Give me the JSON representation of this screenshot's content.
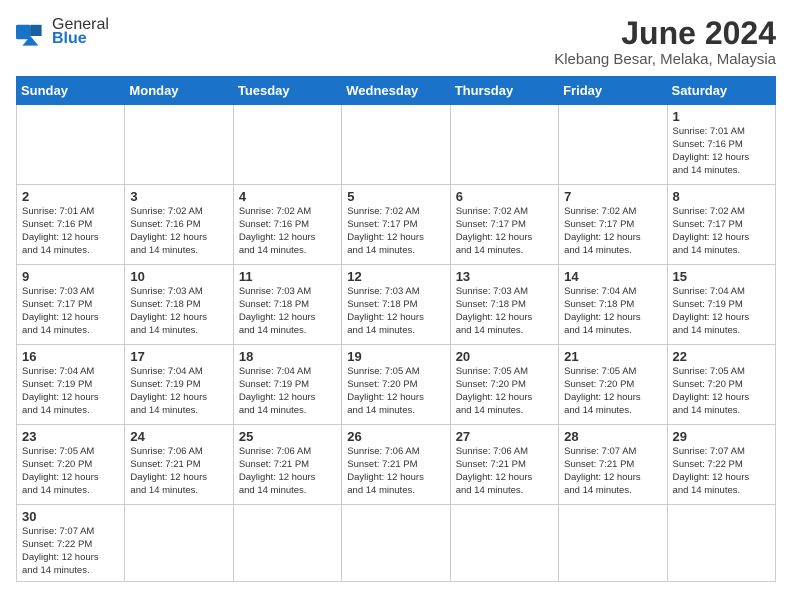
{
  "logo": {
    "text_general": "General",
    "text_blue": "Blue"
  },
  "header": {
    "title": "June 2024",
    "subtitle": "Klebang Besar, Melaka, Malaysia"
  },
  "weekdays": [
    "Sunday",
    "Monday",
    "Tuesday",
    "Wednesday",
    "Thursday",
    "Friday",
    "Saturday"
  ],
  "weeks": [
    [
      {
        "day": "",
        "info": ""
      },
      {
        "day": "",
        "info": ""
      },
      {
        "day": "",
        "info": ""
      },
      {
        "day": "",
        "info": ""
      },
      {
        "day": "",
        "info": ""
      },
      {
        "day": "",
        "info": ""
      },
      {
        "day": "1",
        "info": "Sunrise: 7:01 AM\nSunset: 7:16 PM\nDaylight: 12 hours\nand 14 minutes."
      }
    ],
    [
      {
        "day": "2",
        "info": "Sunrise: 7:01 AM\nSunset: 7:16 PM\nDaylight: 12 hours\nand 14 minutes."
      },
      {
        "day": "3",
        "info": "Sunrise: 7:02 AM\nSunset: 7:16 PM\nDaylight: 12 hours\nand 14 minutes."
      },
      {
        "day": "4",
        "info": "Sunrise: 7:02 AM\nSunset: 7:16 PM\nDaylight: 12 hours\nand 14 minutes."
      },
      {
        "day": "5",
        "info": "Sunrise: 7:02 AM\nSunset: 7:17 PM\nDaylight: 12 hours\nand 14 minutes."
      },
      {
        "day": "6",
        "info": "Sunrise: 7:02 AM\nSunset: 7:17 PM\nDaylight: 12 hours\nand 14 minutes."
      },
      {
        "day": "7",
        "info": "Sunrise: 7:02 AM\nSunset: 7:17 PM\nDaylight: 12 hours\nand 14 minutes."
      },
      {
        "day": "8",
        "info": "Sunrise: 7:02 AM\nSunset: 7:17 PM\nDaylight: 12 hours\nand 14 minutes."
      }
    ],
    [
      {
        "day": "9",
        "info": "Sunrise: 7:03 AM\nSunset: 7:17 PM\nDaylight: 12 hours\nand 14 minutes."
      },
      {
        "day": "10",
        "info": "Sunrise: 7:03 AM\nSunset: 7:18 PM\nDaylight: 12 hours\nand 14 minutes."
      },
      {
        "day": "11",
        "info": "Sunrise: 7:03 AM\nSunset: 7:18 PM\nDaylight: 12 hours\nand 14 minutes."
      },
      {
        "day": "12",
        "info": "Sunrise: 7:03 AM\nSunset: 7:18 PM\nDaylight: 12 hours\nand 14 minutes."
      },
      {
        "day": "13",
        "info": "Sunrise: 7:03 AM\nSunset: 7:18 PM\nDaylight: 12 hours\nand 14 minutes."
      },
      {
        "day": "14",
        "info": "Sunrise: 7:04 AM\nSunset: 7:18 PM\nDaylight: 12 hours\nand 14 minutes."
      },
      {
        "day": "15",
        "info": "Sunrise: 7:04 AM\nSunset: 7:19 PM\nDaylight: 12 hours\nand 14 minutes."
      }
    ],
    [
      {
        "day": "16",
        "info": "Sunrise: 7:04 AM\nSunset: 7:19 PM\nDaylight: 12 hours\nand 14 minutes."
      },
      {
        "day": "17",
        "info": "Sunrise: 7:04 AM\nSunset: 7:19 PM\nDaylight: 12 hours\nand 14 minutes."
      },
      {
        "day": "18",
        "info": "Sunrise: 7:04 AM\nSunset: 7:19 PM\nDaylight: 12 hours\nand 14 minutes."
      },
      {
        "day": "19",
        "info": "Sunrise: 7:05 AM\nSunset: 7:20 PM\nDaylight: 12 hours\nand 14 minutes."
      },
      {
        "day": "20",
        "info": "Sunrise: 7:05 AM\nSunset: 7:20 PM\nDaylight: 12 hours\nand 14 minutes."
      },
      {
        "day": "21",
        "info": "Sunrise: 7:05 AM\nSunset: 7:20 PM\nDaylight: 12 hours\nand 14 minutes."
      },
      {
        "day": "22",
        "info": "Sunrise: 7:05 AM\nSunset: 7:20 PM\nDaylight: 12 hours\nand 14 minutes."
      }
    ],
    [
      {
        "day": "23",
        "info": "Sunrise: 7:05 AM\nSunset: 7:20 PM\nDaylight: 12 hours\nand 14 minutes."
      },
      {
        "day": "24",
        "info": "Sunrise: 7:06 AM\nSunset: 7:21 PM\nDaylight: 12 hours\nand 14 minutes."
      },
      {
        "day": "25",
        "info": "Sunrise: 7:06 AM\nSunset: 7:21 PM\nDaylight: 12 hours\nand 14 minutes."
      },
      {
        "day": "26",
        "info": "Sunrise: 7:06 AM\nSunset: 7:21 PM\nDaylight: 12 hours\nand 14 minutes."
      },
      {
        "day": "27",
        "info": "Sunrise: 7:06 AM\nSunset: 7:21 PM\nDaylight: 12 hours\nand 14 minutes."
      },
      {
        "day": "28",
        "info": "Sunrise: 7:07 AM\nSunset: 7:21 PM\nDaylight: 12 hours\nand 14 minutes."
      },
      {
        "day": "29",
        "info": "Sunrise: 7:07 AM\nSunset: 7:22 PM\nDaylight: 12 hours\nand 14 minutes."
      }
    ],
    [
      {
        "day": "30",
        "info": "Sunrise: 7:07 AM\nSunset: 7:22 PM\nDaylight: 12 hours\nand 14 minutes."
      },
      {
        "day": "",
        "info": ""
      },
      {
        "day": "",
        "info": ""
      },
      {
        "day": "",
        "info": ""
      },
      {
        "day": "",
        "info": ""
      },
      {
        "day": "",
        "info": ""
      },
      {
        "day": "",
        "info": ""
      }
    ]
  ]
}
